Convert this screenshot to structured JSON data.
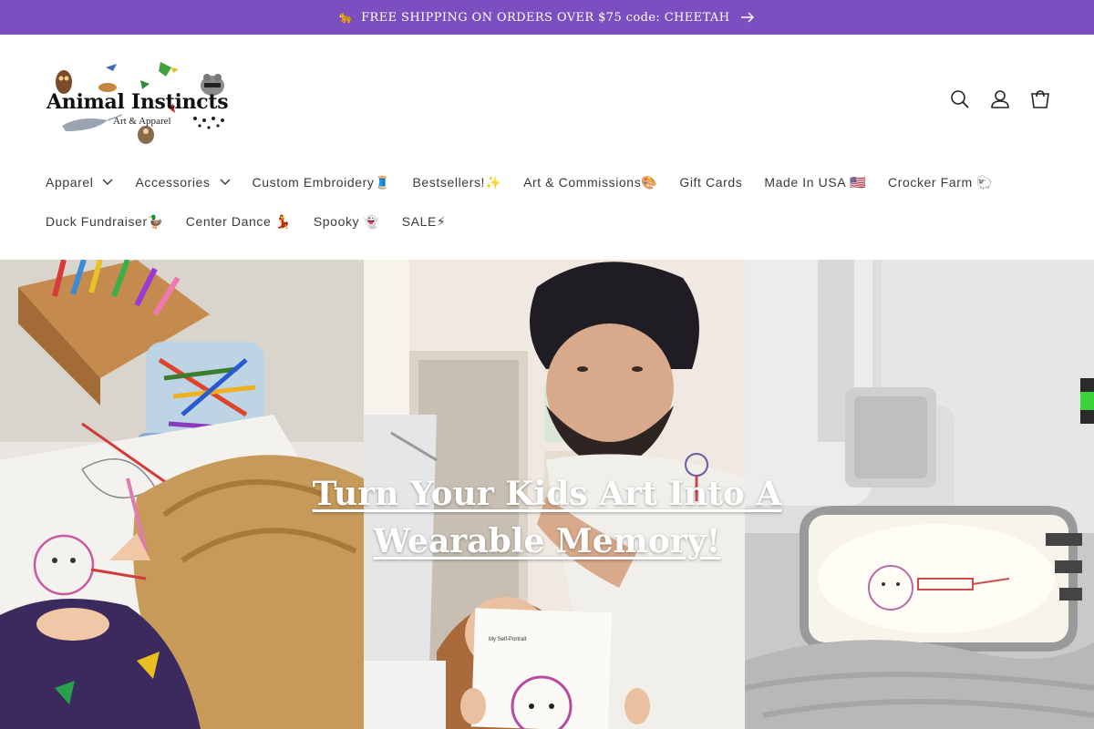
{
  "announcement": {
    "emoji": "🐆",
    "text": "FREE SHIPPING ON ORDERS OVER $75 code: CHEETAH",
    "icon": "arrow-right-icon",
    "bg_color": "#7b4fc0"
  },
  "logo": {
    "name": "Animal Instincts",
    "sub": "Art & Apparel"
  },
  "header_icons": [
    "search-icon",
    "account-icon",
    "cart-icon"
  ],
  "nav": {
    "row1": [
      {
        "label": "Apparel",
        "dropdown": true
      },
      {
        "label": "Accessories",
        "dropdown": true
      },
      {
        "label": "Custom Embroidery🧵",
        "dropdown": false
      },
      {
        "label": "Bestsellers!✨",
        "dropdown": false
      },
      {
        "label": "Art & Commissions🎨",
        "dropdown": false
      },
      {
        "label": "Gift Cards",
        "dropdown": false
      },
      {
        "label": "Made In USA 🇺🇸",
        "dropdown": false
      },
      {
        "label": "Crocker Farm 🐑",
        "dropdown": false
      }
    ],
    "row2": [
      {
        "label": "Duck Fundraiser🦆",
        "dropdown": false
      },
      {
        "label": "Center Dance 💃",
        "dropdown": false
      },
      {
        "label": "Spooky 👻",
        "dropdown": false
      },
      {
        "label": "SALE⚡",
        "dropdown": false
      }
    ]
  },
  "hero": {
    "title_line1": "Turn Your Kids Art Into A",
    "title_line2": "Wearable Memory!",
    "paper_caption": "My Self-Portrait"
  }
}
